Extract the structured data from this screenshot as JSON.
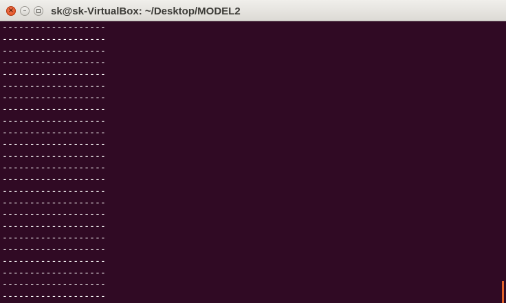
{
  "window": {
    "title": "sk@sk-VirtualBox: ~/Desktop/MODEL2",
    "buttons": {
      "close_icon": "close-icon",
      "minimize_icon": "minimize-icon",
      "maximize_icon": "maximize-icon"
    }
  },
  "terminal": {
    "lines": [
      "-------------------",
      "-------------------",
      "-------------------",
      "-------------------",
      "-------------------",
      "-------------------",
      "-------------------",
      "-------------------",
      "-------------------",
      "-------------------",
      "-------------------",
      "-------------------",
      "-------------------",
      "-------------------",
      "-------------------",
      "-------------------",
      "-------------------",
      "-------------------",
      "-------------------",
      "-------------------",
      "-------------------",
      "-------------------",
      "-------------------",
      "-------------------"
    ],
    "colors": {
      "background": "#300a24",
      "text": "#ffffff",
      "cursor": "#e0622a"
    }
  }
}
